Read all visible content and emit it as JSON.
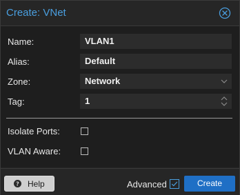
{
  "window": {
    "title": "Create: VNet",
    "close_icon": "close-circle-icon"
  },
  "form": {
    "name": {
      "label": "Name:",
      "value": "VLAN1"
    },
    "alias": {
      "label": "Alias:",
      "value": "Default"
    },
    "zone": {
      "label": "Zone:",
      "value": "Network"
    },
    "tag": {
      "label": "Tag:",
      "value": "1"
    },
    "isolate_ports": {
      "label": "Isolate Ports:",
      "checked": false
    },
    "vlan_aware": {
      "label": "VLAN Aware:",
      "checked": false
    }
  },
  "footer": {
    "help_label": "Help",
    "help_icon": "question-circle-icon",
    "advanced_label": "Advanced",
    "advanced_checked": true,
    "create_label": "Create"
  },
  "colors": {
    "accent": "#4a9fe0",
    "primary_button": "#1f6fc5",
    "background": "#1e1e1e",
    "panel": "#262626",
    "field": "#2c2c2c"
  }
}
